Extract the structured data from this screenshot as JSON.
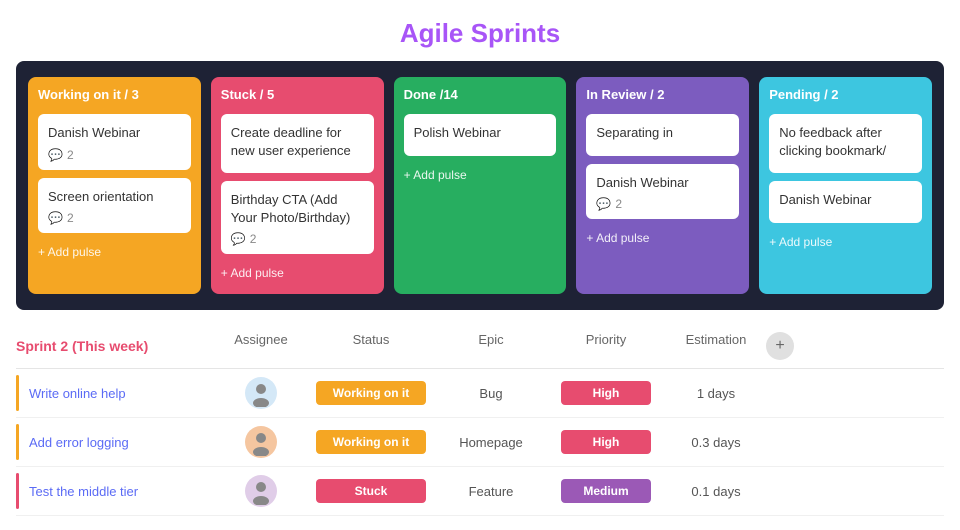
{
  "header": {
    "title": "Agile Sprints"
  },
  "kanban": {
    "columns": [
      {
        "id": "working",
        "label": "Working on it / 3",
        "color_class": "col-working",
        "cards": [
          {
            "title": "Danish Webinar",
            "comments": 2
          },
          {
            "title": "Screen orientation",
            "comments": 2
          }
        ],
        "add_label": "+ Add pulse"
      },
      {
        "id": "stuck",
        "label": "Stuck / 5",
        "color_class": "col-stuck",
        "cards": [
          {
            "title": "Create deadline for new user experience",
            "comments": null
          },
          {
            "title": "Birthday CTA (Add Your Photo/Birthday)",
            "comments": 2
          }
        ],
        "add_label": "+ Add pulse"
      },
      {
        "id": "done",
        "label": "Done /14",
        "color_class": "col-done",
        "cards": [
          {
            "title": "Polish Webinar",
            "comments": null
          }
        ],
        "add_label": "+ Add pulse"
      },
      {
        "id": "review",
        "label": "In Review / 2",
        "color_class": "col-review",
        "cards": [
          {
            "title": "Separating in",
            "comments": null
          },
          {
            "title": "Danish Webinar",
            "comments": 2
          }
        ],
        "add_label": "+ Add pulse"
      },
      {
        "id": "pending",
        "label": "Pending / 2",
        "color_class": "col-pending",
        "cards": [
          {
            "title": "No feedback after clicking bookmark/",
            "comments": null
          },
          {
            "title": "Danish Webinar",
            "comments": null
          }
        ],
        "add_label": "+ Add pulse"
      }
    ]
  },
  "sprint": {
    "title": "Sprint 2 (This week)",
    "columns": {
      "assignee": "Assignee",
      "status": "Status",
      "epic": "Epic",
      "priority": "Priority",
      "estimation": "Estimation"
    },
    "rows": [
      {
        "task": "Write online help",
        "assignee_icon": "👤",
        "assignee_class": "avatar-person1",
        "status": "Working on it",
        "status_class": "status-working",
        "epic": "Bug",
        "priority": "High",
        "priority_class": "priority-high",
        "estimation": "1 days"
      },
      {
        "task": "Add error logging",
        "assignee_icon": "👤",
        "assignee_class": "avatar-person2",
        "status": "Working on it",
        "status_class": "status-working",
        "epic": "Homepage",
        "priority": "High",
        "priority_class": "priority-high",
        "estimation": "0.3 days"
      },
      {
        "task": "Test the middle tier",
        "assignee_icon": "👤",
        "assignee_class": "avatar-person3",
        "status": "Stuck",
        "status_class": "status-stuck",
        "epic": "Feature",
        "priority": "Medium",
        "priority_class": "priority-medium",
        "estimation": "0.1 days"
      }
    ]
  }
}
